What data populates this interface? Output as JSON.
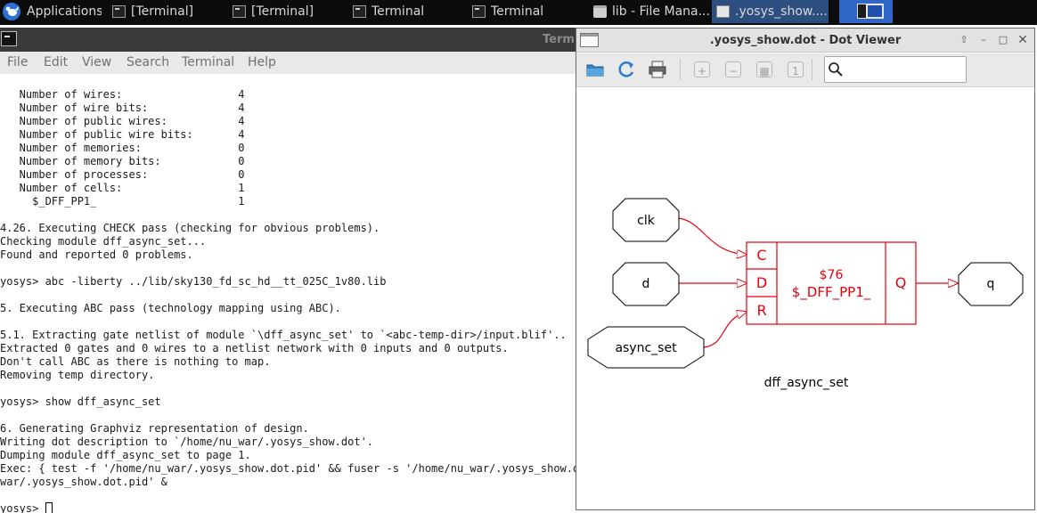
{
  "panel": {
    "applications_label": "Applications",
    "tasks": [
      {
        "label": "[Terminal]"
      },
      {
        "label": "[Terminal]"
      },
      {
        "label": "Terminal"
      },
      {
        "label": "Terminal"
      },
      {
        "label": "lib - File Mana..."
      },
      {
        "label": ".yosys_show...."
      }
    ]
  },
  "terminal": {
    "title": "Termi",
    "menu": [
      "File",
      "Edit",
      "View",
      "Search",
      "Terminal",
      "Help"
    ],
    "lines": [
      "   Number of wires:                  4",
      "   Number of wire bits:              4",
      "   Number of public wires:           4",
      "   Number of public wire bits:       4",
      "   Number of memories:               0",
      "   Number of memory bits:            0",
      "   Number of processes:              0",
      "   Number of cells:                  1",
      "     $_DFF_PP1_                      1",
      "",
      "4.26. Executing CHECK pass (checking for obvious problems).",
      "Checking module dff_async_set...",
      "Found and reported 0 problems.",
      "",
      "yosys> abc -liberty ../lib/sky130_fd_sc_hd__tt_025C_1v80.lib",
      "",
      "5. Executing ABC pass (technology mapping using ABC).",
      "",
      "5.1. Extracting gate netlist of module `\\dff_async_set' to `<abc-temp-dir>/input.blif'..",
      "Extracted 0 gates and 0 wires to a netlist network with 0 inputs and 0 outputs.",
      "Don't call ABC as there is nothing to map.",
      "Removing temp directory.",
      "",
      "yosys> show dff_async_set",
      "",
      "6. Generating Graphviz representation of design.",
      "Writing dot description to `/home/nu_war/.yosys_show.dot'.",
      "Dumping module dff_async_set to page 1.",
      "Exec: { test -f '/home/nu_war/.yosys_show.dot.pid' && fuser -s '/home/nu_war/.yosys_show.dot",
      "war/.yosys_show.dot.pid' &",
      ""
    ],
    "prompt": "yosys> "
  },
  "dotviewer": {
    "title": ".yosys_show.dot - Dot Viewer",
    "search_value": "",
    "graph": {
      "inputs": [
        "clk",
        "d",
        "async_set"
      ],
      "output": "q",
      "cell_id": "$76",
      "cell_type": "$_DFF_PP1_",
      "ports_in": [
        "C",
        "D",
        "R"
      ],
      "port_out": "Q",
      "module_name": "dff_async_set",
      "cell_color": "#e8000b"
    }
  }
}
